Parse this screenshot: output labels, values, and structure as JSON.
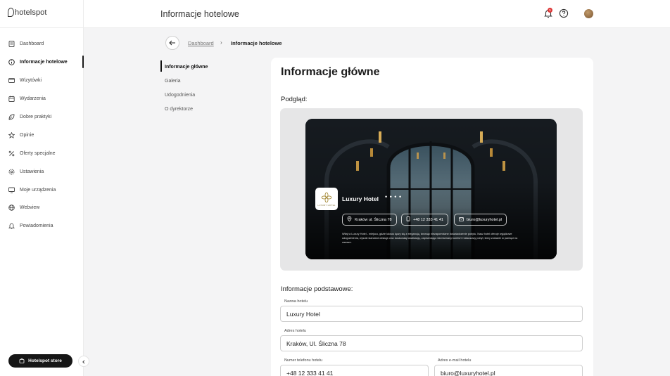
{
  "app": {
    "logo_text": "hotelspot"
  },
  "sidebar": {
    "items": [
      {
        "label": "Dashboard",
        "icon": "document-icon"
      },
      {
        "label": "Informacje hotelowe",
        "icon": "info-icon",
        "active": true
      },
      {
        "label": "Wizytówki",
        "icon": "card-icon"
      },
      {
        "label": "Wydarzenia",
        "icon": "calendar-icon"
      },
      {
        "label": "Dobre praktyki",
        "icon": "leaf-icon"
      },
      {
        "label": "Opinie",
        "icon": "star-icon"
      },
      {
        "label": "Oferty specjalne",
        "icon": "percent-icon"
      },
      {
        "label": "Ustawienia",
        "icon": "gear-icon"
      },
      {
        "label": "Moje urządzenia",
        "icon": "monitor-icon"
      },
      {
        "label": "Webview",
        "icon": "globe-icon"
      },
      {
        "label": "Powiadomienia",
        "icon": "bell-icon"
      }
    ],
    "store_button": "Hotelspot store"
  },
  "topbar": {
    "title": "Informacje hotelowe",
    "notification_count": "1"
  },
  "breadcrumb": {
    "link": "Dashboard",
    "separator": "›",
    "current": "Informacje hotelowe"
  },
  "subnav": {
    "items": [
      {
        "label": "Informacje główne",
        "active": true
      },
      {
        "label": "Galeria"
      },
      {
        "label": "Udogodnienia"
      },
      {
        "label": "O dyrektorze"
      }
    ]
  },
  "main": {
    "title": "Informacje główne",
    "preview_label": "Podgląd:",
    "preview": {
      "logo_text": "LUXURY HOTEL",
      "hotel_name": "Luxury Hotel",
      "dots": "• • • •",
      "address": "Kraków ul. Śliczna 78",
      "phone": "+48 12 333 41 41",
      "email": "biuro@luxuryhotel.pl",
      "description": "Witaj w Luxury Hotel - miejscu, gdzie luksus łączy się z elegancją, tworząc niezapomniane doświadczenie pobytu. Nasz hotel oferuje wyjątkowe udogodnienia, wysoki standard obsługi oraz doskonałą lokalizację, zapewniając niezrównany komfort i luksusowy pobyt, który zostanie w pamięci na zawsze."
    },
    "basic_label": "Informacje podstawowe:",
    "fields": {
      "name": {
        "label": "Nazwa hotelu",
        "value": "Luxury Hotel"
      },
      "address": {
        "label": "Adres hotelu",
        "value": "Kraków, Ul. Śliczna 78"
      },
      "phone": {
        "label": "Numer telefonu hotelu",
        "value": "+48 12 333 41 41"
      },
      "email": {
        "label": "Adres e-mail hotelu",
        "value": "biuro@luxuryhotel.pl"
      }
    }
  }
}
